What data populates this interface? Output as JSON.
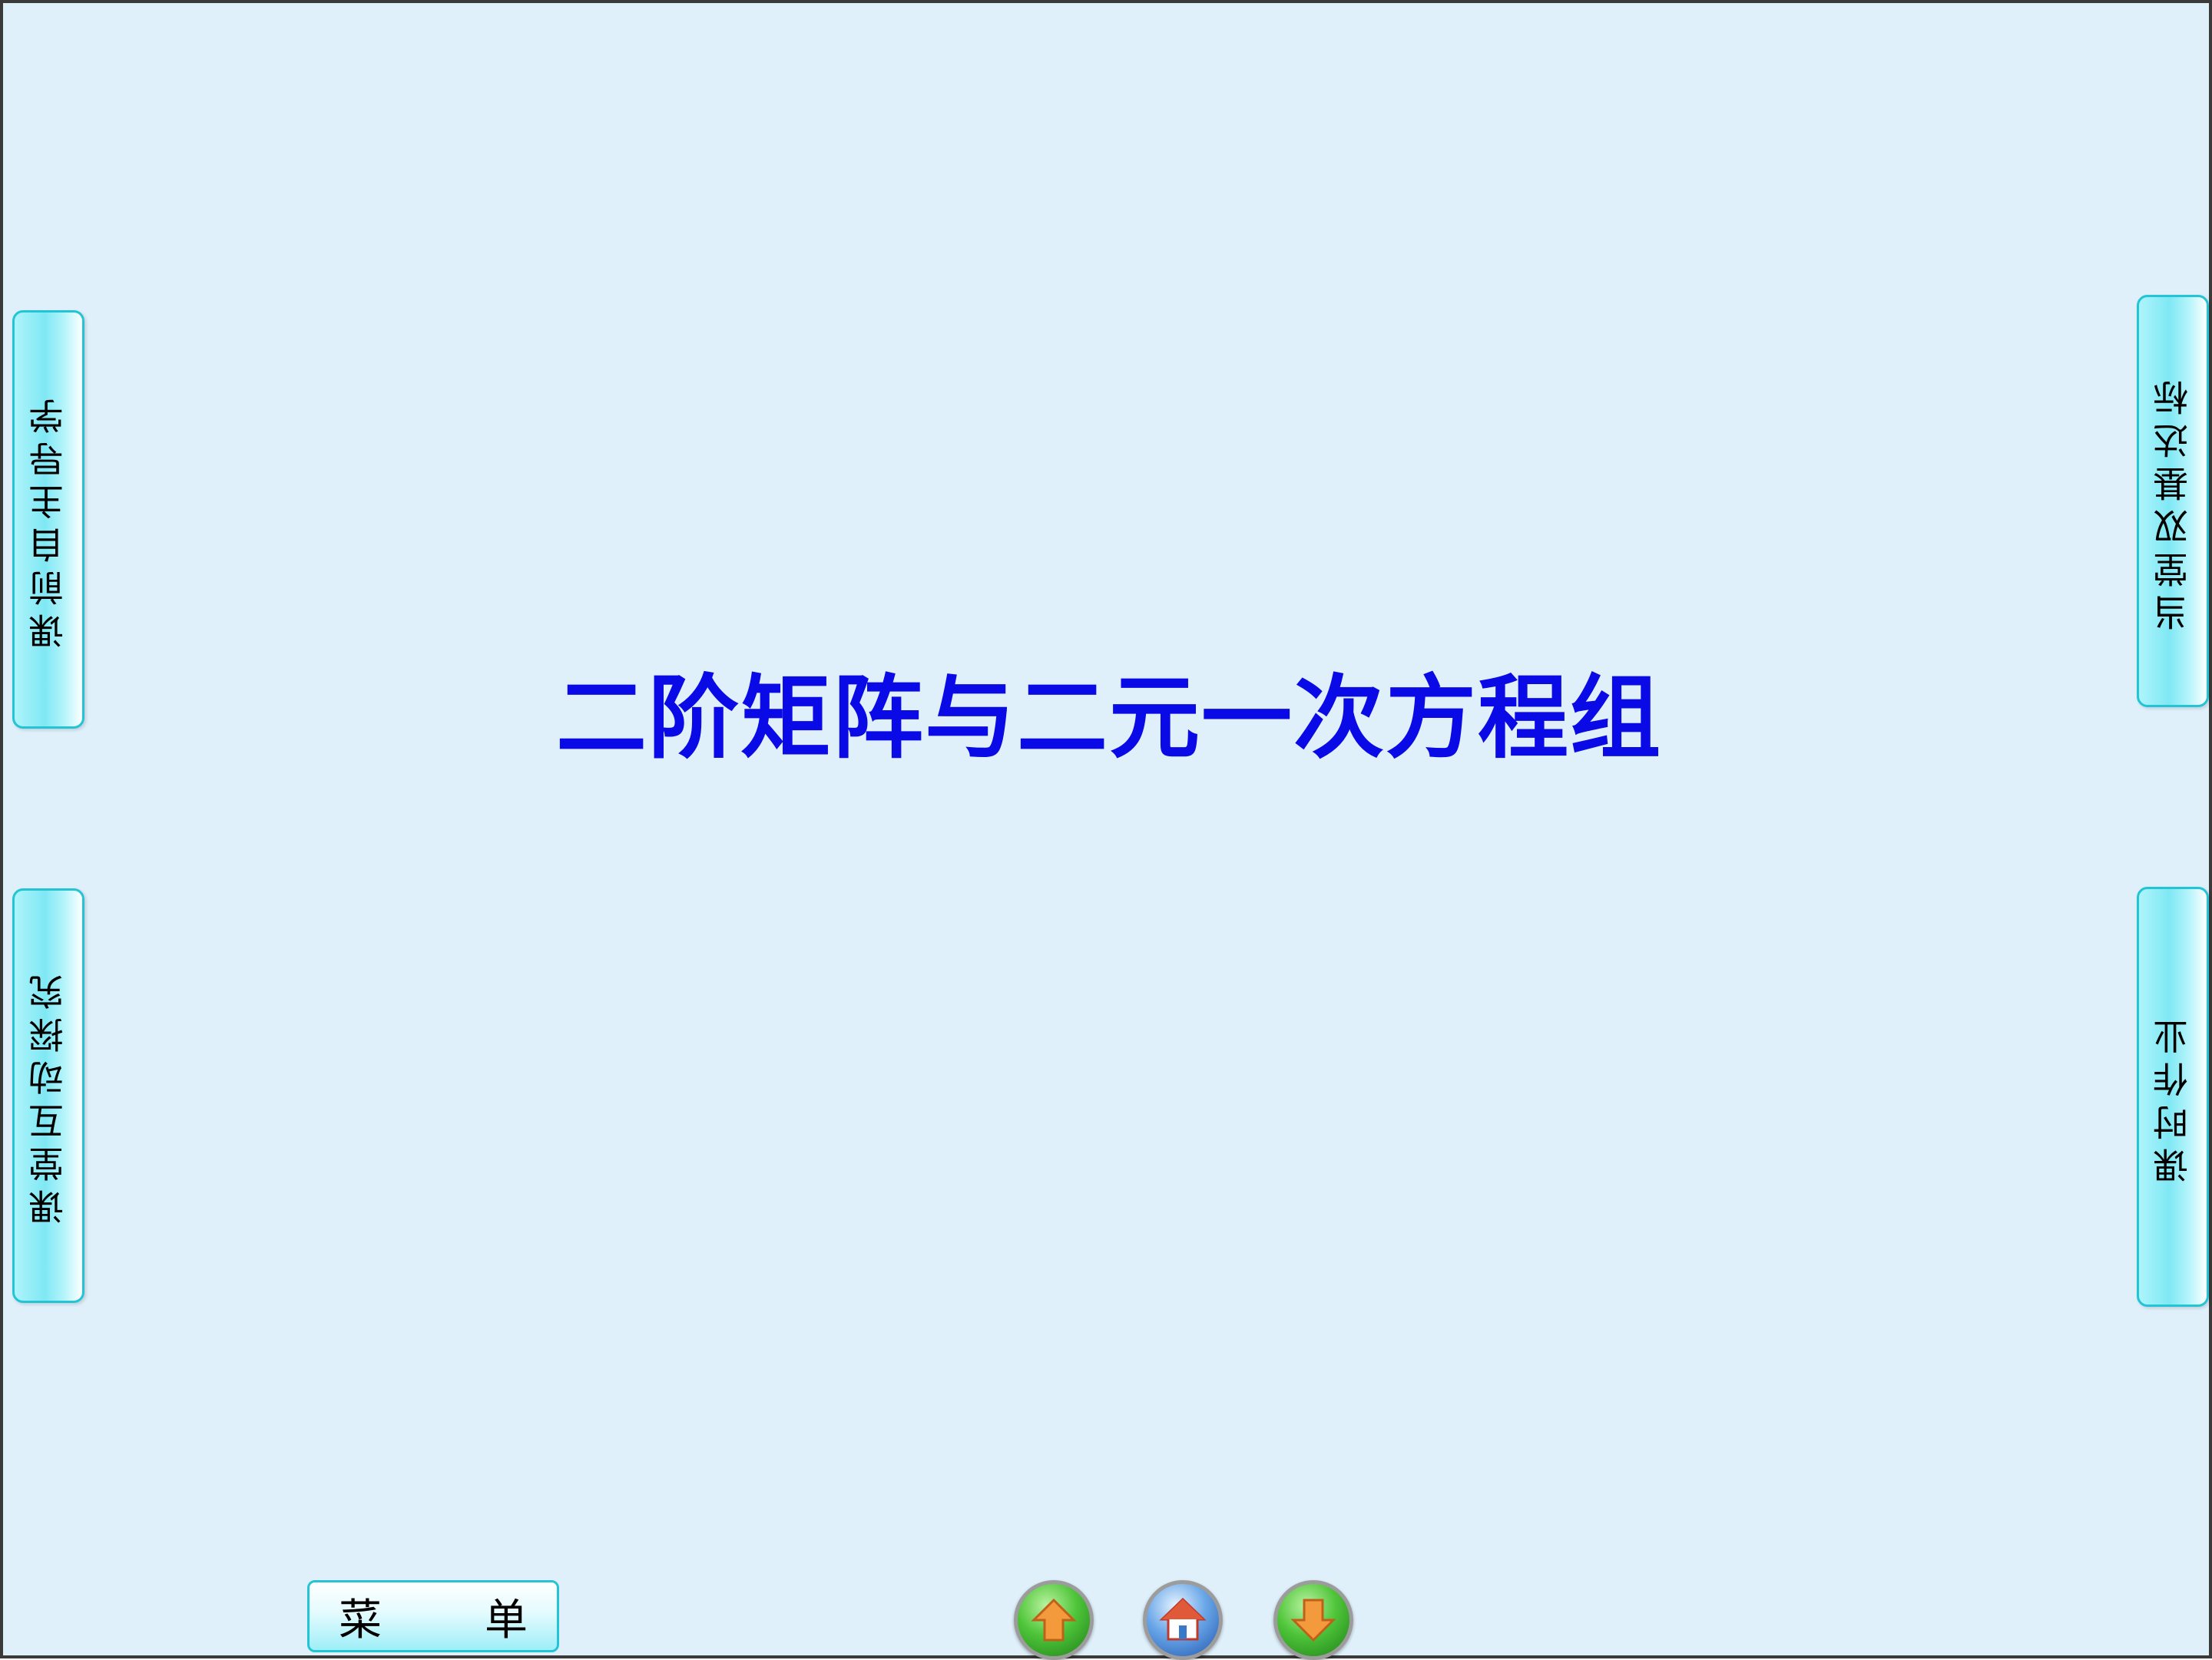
{
  "slide": {
    "title": "二阶矩阵与二元一次方程组"
  },
  "left_tabs": [
    {
      "label": "课前自主导学"
    },
    {
      "label": "课堂互动探究"
    }
  ],
  "right_tabs": [
    {
      "label": "当堂双基达标"
    },
    {
      "label": "课时作业"
    }
  ],
  "bottom_bar": {
    "menu_chars": [
      "菜",
      "单"
    ],
    "nav": [
      {
        "icon": "arrow-up-icon"
      },
      {
        "icon": "home-icon"
      },
      {
        "icon": "arrow-down-icon"
      }
    ]
  },
  "colors": {
    "background": "#dff0fb",
    "title": "#0a0ae6",
    "tab_border": "#22c4d6"
  }
}
